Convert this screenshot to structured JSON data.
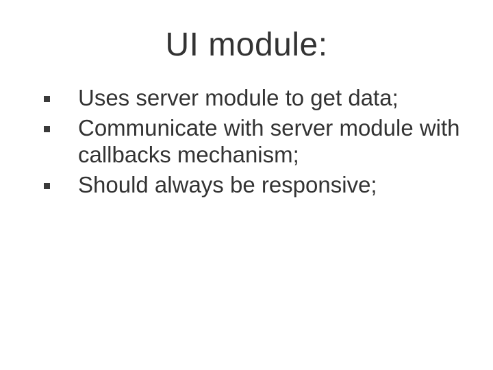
{
  "title": "UI module:",
  "bullets": [
    {
      "text": "Uses server module to get data;"
    },
    {
      "text": "Communicate with server module with callbacks mechanism;"
    },
    {
      "text": "Should always be responsive;"
    }
  ]
}
